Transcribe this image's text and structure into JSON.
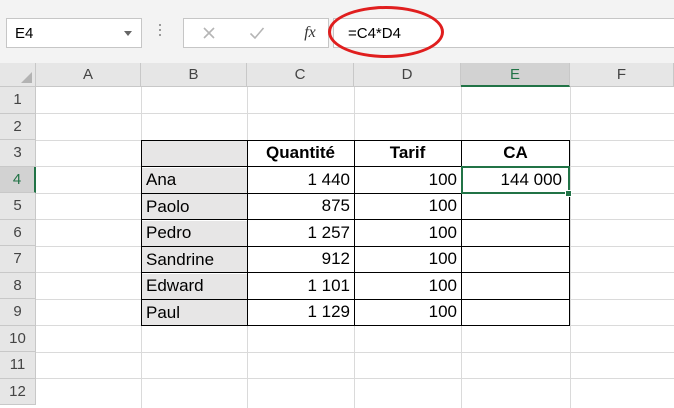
{
  "formula_bar": {
    "name_box": "E4",
    "formula": "=C4*D4",
    "fx_label": "fx"
  },
  "columns": [
    "A",
    "B",
    "C",
    "D",
    "E",
    "F"
  ],
  "selected_column": "E",
  "rows": [
    "1",
    "2",
    "3",
    "4",
    "5",
    "6",
    "7",
    "8",
    "9",
    "10",
    "11",
    "12"
  ],
  "selected_row": "4",
  "table": {
    "headers": {
      "quantite": "Quantité",
      "tarif": "Tarif",
      "ca": "CA"
    },
    "rows": [
      {
        "name": "Ana",
        "qty": "1 440",
        "tarif": "100",
        "ca": "144 000"
      },
      {
        "name": "Paolo",
        "qty": "875",
        "tarif": "100",
        "ca": ""
      },
      {
        "name": "Pedro",
        "qty": "1 257",
        "tarif": "100",
        "ca": ""
      },
      {
        "name": "Sandrine",
        "qty": "912",
        "tarif": "100",
        "ca": ""
      },
      {
        "name": "Edward",
        "qty": "1 101",
        "tarif": "100",
        "ca": ""
      },
      {
        "name": "Paul",
        "qty": "1 129",
        "tarif": "100",
        "ca": ""
      }
    ]
  },
  "colors": {
    "accent_green": "#217346",
    "highlight_red": "#e01e1e",
    "shade": "#e7e6e6"
  }
}
